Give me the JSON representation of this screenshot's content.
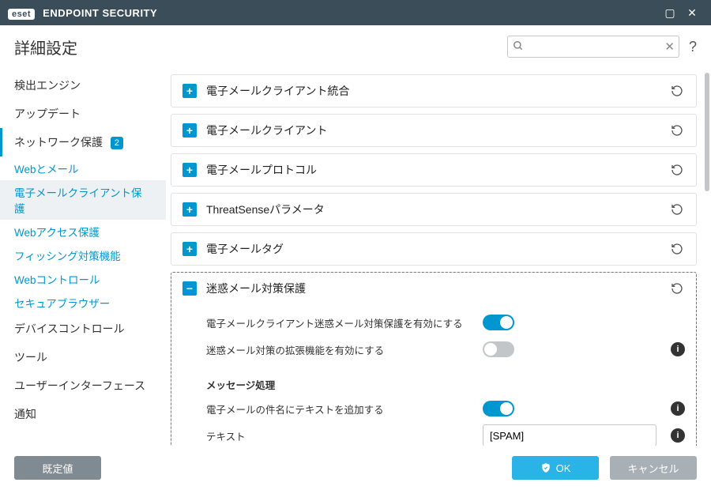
{
  "titlebar": {
    "product": "ENDPOINT SECURITY",
    "brand_badge": "eset"
  },
  "header": {
    "title": "詳細設定",
    "search_placeholder": ""
  },
  "sidebar": {
    "groups": [
      {
        "label": "検出エンジン"
      },
      {
        "label": "アップデート"
      },
      {
        "label": "ネットワーク保護",
        "badge": "2",
        "active": true,
        "subs": [
          {
            "label": "Webとメール"
          },
          {
            "label": "電子メールクライアント保護",
            "selected": true
          },
          {
            "label": "Webアクセス保護"
          },
          {
            "label": "フィッシング対策機能"
          },
          {
            "label": "Webコントロール"
          },
          {
            "label": "セキュアブラウザー"
          }
        ]
      },
      {
        "label": "デバイスコントロール"
      },
      {
        "label": "ツール"
      },
      {
        "label": "ユーザーインターフェース"
      },
      {
        "label": "通知"
      }
    ]
  },
  "sections": [
    {
      "title": "電子メールクライアント統合",
      "expanded": false
    },
    {
      "title": "電子メールクライアント",
      "expanded": false
    },
    {
      "title": "電子メールプロトコル",
      "expanded": false
    },
    {
      "title": "ThreatSenseパラメータ",
      "expanded": false
    },
    {
      "title": "電子メールタグ",
      "expanded": false
    },
    {
      "title": "迷惑メール対策保護",
      "expanded": true,
      "focused": true,
      "rows": [
        {
          "label": "電子メールクライアント迷惑メール対策保護を有効にする",
          "toggle": true
        },
        {
          "label": "迷惑メール対策の拡張機能を有効にする",
          "toggle": false,
          "info": true
        }
      ],
      "subheading": "メッセージ処理",
      "rows2": [
        {
          "label": "電子メールの件名にテキストを追加する",
          "toggle": true,
          "info": true
        },
        {
          "label": "テキスト",
          "input": "[SPAM]",
          "info": true
        }
      ]
    }
  ],
  "footer": {
    "defaults": "既定値",
    "ok": "OK",
    "cancel": "キャンセル"
  }
}
